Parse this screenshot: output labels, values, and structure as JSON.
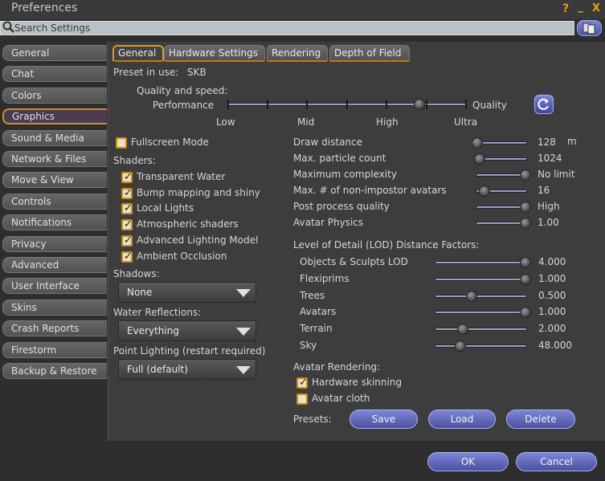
{
  "window": {
    "title": "Preferences",
    "help": "?",
    "minimize": "_",
    "close": "X"
  },
  "search": {
    "placeholder": "Search Settings"
  },
  "sidebar": {
    "items": [
      {
        "label": "General"
      },
      {
        "label": "Chat"
      },
      {
        "label": "Colors"
      },
      {
        "label": "Graphics"
      },
      {
        "label": "Sound & Media"
      },
      {
        "label": "Network & Files"
      },
      {
        "label": "Move & View"
      },
      {
        "label": "Controls"
      },
      {
        "label": "Notifications"
      },
      {
        "label": "Privacy"
      },
      {
        "label": "Advanced"
      },
      {
        "label": "User Interface"
      },
      {
        "label": "Skins"
      },
      {
        "label": "Crash Reports"
      },
      {
        "label": "Firestorm"
      },
      {
        "label": "Backup & Restore"
      }
    ],
    "active_index": 3
  },
  "tabs": [
    {
      "label": "General"
    },
    {
      "label": "Hardware Settings"
    },
    {
      "label": "Rendering"
    },
    {
      "label": "Depth of Field"
    }
  ],
  "general": {
    "preset_label": "Preset in use:",
    "preset_value": "SKB",
    "quality_label": "Quality and speed:",
    "performance_label": "Performance",
    "quality_end_label": "Quality",
    "quality_levels": {
      "low": "Low",
      "mid": "Mid",
      "high": "High",
      "ultra": "Ultra"
    },
    "quality_value_fraction": 0.8,
    "fullscreen": {
      "label": "Fullscreen Mode",
      "checked": false
    },
    "shaders_label": "Shaders:",
    "shaders": [
      {
        "label": "Transparent Water",
        "checked": true
      },
      {
        "label": "Bump mapping and shiny",
        "checked": true
      },
      {
        "label": "Local Lights",
        "checked": true
      },
      {
        "label": "Atmospheric shaders",
        "checked": true
      },
      {
        "label": "Advanced Lighting Model",
        "checked": true
      },
      {
        "label": "Ambient Occlusion",
        "checked": true
      }
    ],
    "shadows_label": "Shadows:",
    "shadows_value": "None",
    "water_label": "Water Reflections:",
    "water_value": "Everything",
    "point_label": "Point Lighting (restart required)",
    "point_value": "Full (default)",
    "sliders": [
      {
        "label": "Draw distance",
        "value": "128",
        "unit": "m",
        "fraction": 0.0
      },
      {
        "label": "Max. particle count",
        "value": "1024",
        "fraction": 0.05
      },
      {
        "label": "Maximum complexity",
        "value": "No limit",
        "fraction": 1.0
      },
      {
        "label": "Max. # of non-impostor avatars",
        "value": "16",
        "fraction": 0.15
      },
      {
        "label": "Post process quality",
        "value": "High",
        "fraction": 1.0
      },
      {
        "label": "Avatar Physics",
        "value": "1.00",
        "fraction": 1.0
      }
    ],
    "lod_label": "Level of Detail (LOD) Distance Factors:",
    "lod": [
      {
        "label": "Objects & Sculpts LOD",
        "value": "4.000",
        "fraction": 1.0
      },
      {
        "label": "Flexiprims",
        "value": "1.000",
        "fraction": 1.0
      },
      {
        "label": "Trees",
        "value": "0.500",
        "fraction": 0.4
      },
      {
        "label": "Avatars",
        "value": "1.000",
        "fraction": 1.0
      },
      {
        "label": "Terrain",
        "value": "2.000",
        "fraction": 0.3
      },
      {
        "label": "Sky",
        "value": "48.000",
        "fraction": 0.27
      }
    ],
    "avatar_rendering_label": "Avatar Rendering:",
    "hardware_skinning": {
      "label": "Hardware skinning",
      "checked": true
    },
    "avatar_cloth": {
      "label": "Avatar cloth",
      "checked": false
    },
    "presets_label": "Presets:",
    "save_label": "Save",
    "load_label": "Load",
    "delete_label": "Delete"
  },
  "footer": {
    "ok_label": "OK",
    "cancel_label": "Cancel"
  }
}
